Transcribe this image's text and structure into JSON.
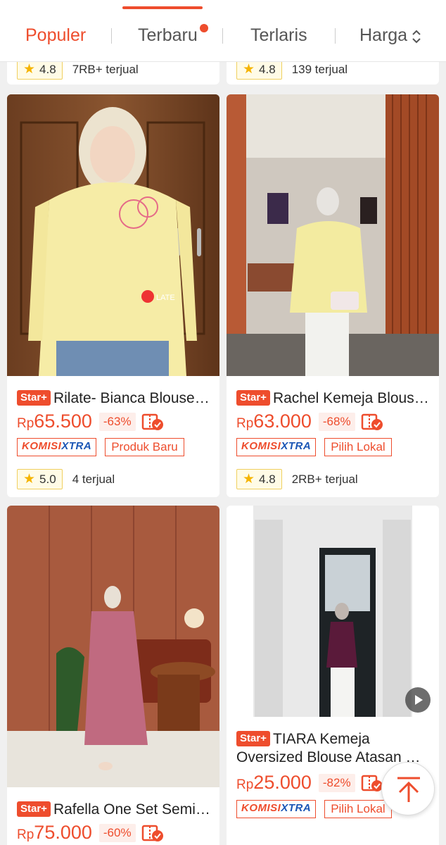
{
  "sort_tabs": [
    {
      "label": "Populer"
    },
    {
      "label": "Terbaru"
    },
    {
      "label": "Terlaris"
    },
    {
      "label": "Harga"
    }
  ],
  "colors": {
    "accent": "#ee4d2d",
    "komisi_blue": "#1a55b5",
    "star": "#f5b400"
  },
  "top_row": [
    {
      "rating": "4.8",
      "sold": "7RB+ terjual"
    },
    {
      "rating": "4.8",
      "sold": "139 terjual"
    }
  ],
  "products": [
    {
      "badge": "Star+",
      "title": "Rilate- Bianca Blouse Kemeja",
      "currency": "Rp",
      "price": "65.500",
      "discount": "-63%",
      "komisi_a": "KOMISI",
      "komisi_b": "XTRA",
      "tag": "Produk Baru",
      "rating": "5.0",
      "sold": "4 terjual",
      "image_watermark": "LATE"
    },
    {
      "badge": "Star+",
      "title": "Rachel Kemeja Blouse Wanita",
      "currency": "Rp",
      "price": "63.000",
      "discount": "-68%",
      "komisi_a": "KOMISI",
      "komisi_b": "XTRA",
      "tag": "Pilih Lokal",
      "rating": "4.8",
      "sold": "2RB+ terjual"
    },
    {
      "badge": "Star+",
      "title": "Rafella One Set Semi Kaftan",
      "currency": "Rp",
      "price": "75.000",
      "discount": "-60%"
    },
    {
      "badge": "Star+",
      "title_line1": "TIARA Kemeja",
      "title_line2": "Oversized Blouse Atasan Wanita",
      "currency": "Rp",
      "price": "25.000",
      "discount": "-82%",
      "komisi_a": "KOMISI",
      "komisi_b": "XTRA",
      "tag": "Pilih Lokal"
    }
  ],
  "icons": {
    "sort_arrows": "sort-arrows-icon",
    "star": "star-icon",
    "free_return": "free-return-icon",
    "play": "play-icon",
    "back_to_top": "back-to-top-icon"
  }
}
